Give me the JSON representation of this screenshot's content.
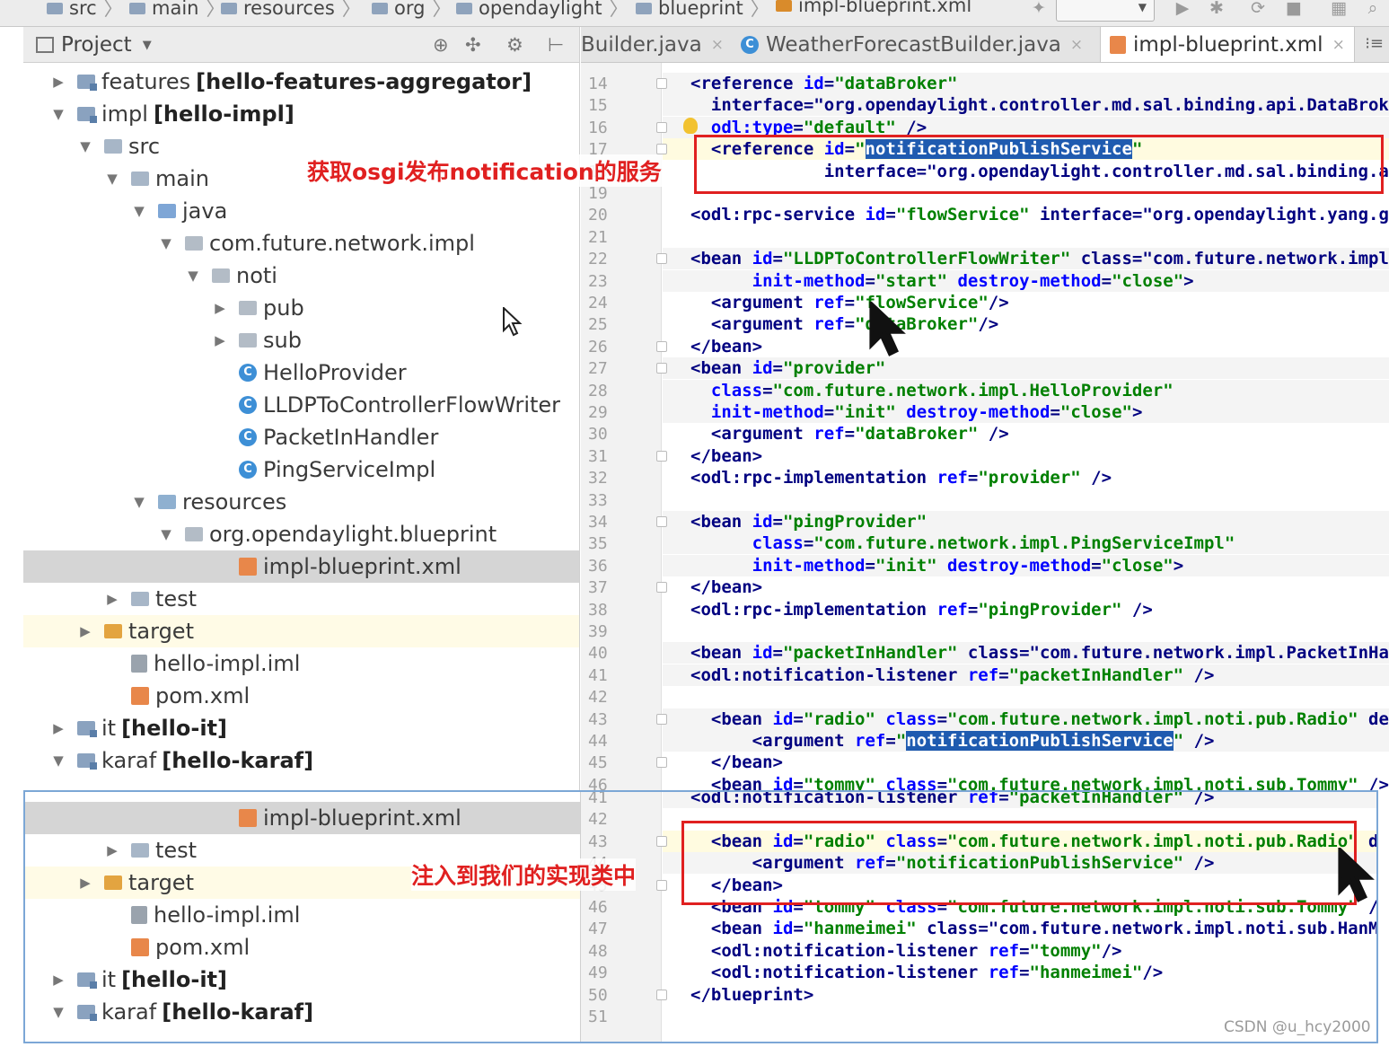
{
  "breadcrumb": [
    "src",
    "main",
    "resources",
    "org",
    "opendaylight",
    "blueprint",
    "impl-blueprint.xml"
  ],
  "project_panel": {
    "title": "Project",
    "tree": [
      {
        "name": "features",
        "module": "[hello-features-aggregator]",
        "icon": "module",
        "arrow": "right"
      },
      {
        "name": "impl",
        "module": "[hello-impl]",
        "icon": "module",
        "arrow": "down"
      },
      {
        "name": "src",
        "icon": "folder",
        "arrow": "down"
      },
      {
        "name": "main",
        "icon": "folder",
        "arrow": "down"
      },
      {
        "name": "java",
        "icon": "src",
        "arrow": "down"
      },
      {
        "name": "com.future.network.impl",
        "icon": "package",
        "arrow": "down"
      },
      {
        "name": "noti",
        "icon": "package",
        "arrow": "down"
      },
      {
        "name": "pub",
        "icon": "package",
        "arrow": "right"
      },
      {
        "name": "sub",
        "icon": "package",
        "arrow": "right"
      },
      {
        "name": "HelloProvider",
        "icon": "class"
      },
      {
        "name": "LLDPToControllerFlowWriter",
        "icon": "class"
      },
      {
        "name": "PacketInHandler",
        "icon": "class"
      },
      {
        "name": "PingServiceImpl",
        "icon": "class"
      },
      {
        "name": "resources",
        "icon": "resources",
        "arrow": "down"
      },
      {
        "name": "org.opendaylight.blueprint",
        "icon": "package",
        "arrow": "down"
      },
      {
        "name": "impl-blueprint.xml",
        "icon": "xml",
        "selected": true
      },
      {
        "name": "test",
        "icon": "folder",
        "arrow": "right"
      },
      {
        "name": "target",
        "icon": "target",
        "arrow": "right",
        "highlight": true
      },
      {
        "name": "hello-impl.iml",
        "icon": "iml"
      },
      {
        "name": "pom.xml",
        "icon": "xml"
      },
      {
        "name": "it",
        "module": "[hello-it]",
        "icon": "module",
        "arrow": "right"
      },
      {
        "name": "karaf",
        "module": "[hello-karaf]",
        "icon": "module",
        "arrow": "down"
      }
    ],
    "zoom_tree": [
      {
        "name": "impl-blueprint.xml",
        "icon": "xml",
        "selected": true
      },
      {
        "name": "test",
        "icon": "folder",
        "arrow": "right"
      },
      {
        "name": "target",
        "icon": "target",
        "arrow": "right",
        "highlight": true
      },
      {
        "name": "hello-impl.iml",
        "icon": "iml"
      },
      {
        "name": "pom.xml",
        "icon": "xml"
      },
      {
        "name": "it",
        "module": "[hello-it]",
        "icon": "module",
        "arrow": "right"
      },
      {
        "name": "karaf",
        "module": "[hello-karaf]",
        "icon": "module",
        "arrow": "down"
      }
    ]
  },
  "editor_tabs": [
    {
      "label": "Builder.java",
      "type": "java"
    },
    {
      "label": "WeatherForecastBuilder.java",
      "type": "java"
    },
    {
      "label": "impl-blueprint.xml",
      "type": "xml",
      "active": true
    }
  ],
  "code_lines": [
    {
      "n": "14",
      "text": "<reference id=\"dataBroker\""
    },
    {
      "n": "15",
      "text": "  interface=\"org.opendaylight.controller.md.sal.binding.api.DataBrok"
    },
    {
      "n": "16",
      "text": "  odl:type=\"default\" />"
    },
    {
      "n": "17",
      "text": "  <reference id=\"notificationPublishService\""
    },
    {
      "n": "18",
      "text": "             interface=\"org.opendaylight.controller.md.sal.binding.a"
    },
    {
      "n": "19",
      "text": ""
    },
    {
      "n": "20",
      "text": "<odl:rpc-service id=\"flowService\" interface=\"org.opendaylight.yang.g"
    },
    {
      "n": "21",
      "text": ""
    },
    {
      "n": "22",
      "text": "<bean id=\"LLDPToControllerFlowWriter\" class=\"com.future.network.impl"
    },
    {
      "n": "23",
      "text": "      init-method=\"start\" destroy-method=\"close\">"
    },
    {
      "n": "24",
      "text": "  <argument ref=\"flowService\"/>"
    },
    {
      "n": "25",
      "text": "  <argument ref=\"dataBroker\"/>"
    },
    {
      "n": "26",
      "text": "</bean>"
    },
    {
      "n": "27",
      "text": "<bean id=\"provider\""
    },
    {
      "n": "28",
      "text": "  class=\"com.future.network.impl.HelloProvider\""
    },
    {
      "n": "29",
      "text": "  init-method=\"init\" destroy-method=\"close\">"
    },
    {
      "n": "30",
      "text": "  <argument ref=\"dataBroker\" />"
    },
    {
      "n": "31",
      "text": "</bean>"
    },
    {
      "n": "32",
      "text": "<odl:rpc-implementation ref=\"provider\" />"
    },
    {
      "n": "33",
      "text": ""
    },
    {
      "n": "34",
      "text": "<bean id=\"pingProvider\""
    },
    {
      "n": "35",
      "text": "      class=\"com.future.network.impl.PingServiceImpl\""
    },
    {
      "n": "36",
      "text": "      init-method=\"init\" destroy-method=\"close\">"
    },
    {
      "n": "37",
      "text": "</bean>"
    },
    {
      "n": "38",
      "text": "<odl:rpc-implementation ref=\"pingProvider\" />"
    },
    {
      "n": "39",
      "text": ""
    },
    {
      "n": "40",
      "text": "<bean id=\"packetInHandler\" class=\"com.future.network.impl.PacketInHa"
    },
    {
      "n": "41",
      "text": "<odl:notification-listener ref=\"packetInHandler\" />"
    },
    {
      "n": "42",
      "text": ""
    },
    {
      "n": "43",
      "text": "  <bean id=\"radio\" class=\"com.future.network.impl.noti.pub.Radio\" de"
    },
    {
      "n": "44",
      "text": "      <argument ref=\"notificationPublishService\" />"
    },
    {
      "n": "45",
      "text": "  </bean>"
    },
    {
      "n": "46",
      "text": "  <bean id=\"tommy\" class=\"com.future.network.impl.noti.sub.Tommy\" />"
    }
  ],
  "zoom_code_lines": [
    {
      "n": "41",
      "text": "<odl:notification-listener ref=\"packetInHandler\" />"
    },
    {
      "n": "42",
      "text": ""
    },
    {
      "n": "43",
      "text": "  <bean id=\"radio\" class=\"com.future.network.impl.noti.pub.Radio\" d"
    },
    {
      "n": "44",
      "text": "      <argument ref=\"notificationPublishService\" />"
    },
    {
      "n": "45",
      "text": "  </bean>"
    },
    {
      "n": "46",
      "text": "  <bean id=\"tommy\" class=\"com.future.network.impl.noti.sub.Tommy\" /"
    },
    {
      "n": "47",
      "text": "  <bean id=\"hanmeimei\" class=\"com.future.network.impl.noti.sub.HanM"
    },
    {
      "n": "48",
      "text": "  <odl:notification-listener ref=\"tommy\"/>"
    },
    {
      "n": "49",
      "text": "  <odl:notification-listener ref=\"hanmeimei\"/>"
    },
    {
      "n": "50",
      "text": "</blueprint>"
    },
    {
      "n": "51",
      "text": ""
    }
  ],
  "annotations": {
    "top": "获取osgi发布notification的服务",
    "bottom": "注入到我们的实现类中"
  },
  "watermark": "CSDN @u_hcy2000",
  "colors": {
    "annotation_red": "#e02020",
    "selection_blue": "#1f5bb0",
    "frame_blue": "#7ca7d6"
  }
}
